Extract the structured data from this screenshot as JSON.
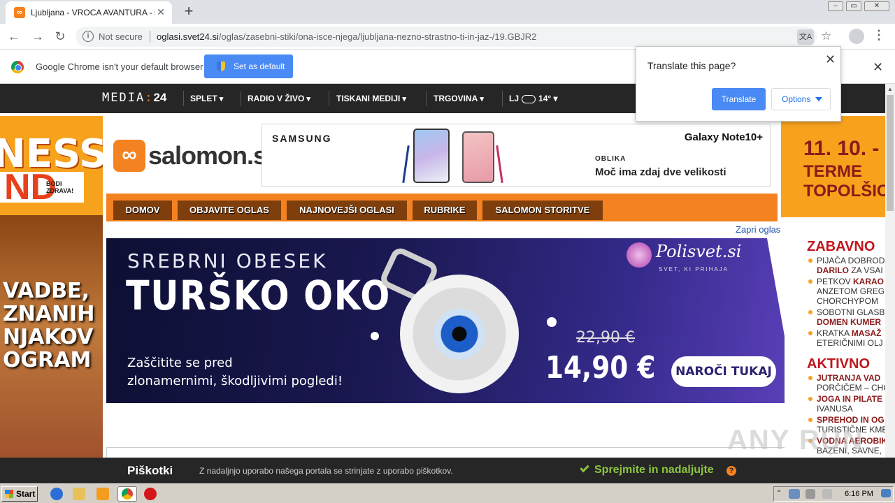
{
  "browser": {
    "tab_title": "Ljubljana - VROCA AVANTURA - salo",
    "tab_close": "✕",
    "new_tab": "+",
    "not_secure": "Not secure",
    "url_host": "oglasi.svet24.si",
    "url_path": "/oglas/zasebni-stiki/ona-isce-njega/ljubljana-nezno-strastno-ti-in-jaz-/19.GBJR2",
    "back": "←",
    "forward": "→",
    "reload": "↻",
    "star": "☆",
    "menu": "⋮"
  },
  "infobar": {
    "message": "Google Chrome isn't your default browser",
    "button": "Set as default",
    "close": "✕"
  },
  "translate_popup": {
    "question": "Translate this page?",
    "translate": "Translate",
    "options": "Options",
    "close": "✕"
  },
  "media24_bar": {
    "logo_text": "MEDIA",
    "logo_num": "24",
    "nav": [
      "SPLET",
      "RADIO V ŽIVO",
      "TISKANI MEDIJI",
      "TRGOVINA"
    ],
    "weather_city": "LJ",
    "weather_temp": "14°"
  },
  "left_ad": {
    "headline": "NESS",
    "nd": "ND",
    "tagline": "BODI ZDRAVA!",
    "lines": "VADBE,\nZNANIH\nNJAKOV\nOGRAM"
  },
  "site": {
    "logo": "salomon.si",
    "nav": [
      "DOMOV",
      "OBJAVITE OGLAS",
      "NAJNOVEJŠI OGLASI",
      "RUBRIKE",
      "SALOMON STORITVE"
    ],
    "close_ad": "Zapri oglas"
  },
  "samsung_ad": {
    "brand": "SAMSUNG",
    "model": "Galaxy Note10+",
    "label": "OBLIKA",
    "tagline": "Moč ima zdaj dve velikosti"
  },
  "banner": {
    "subtitle": "SREBRNI OBESEK",
    "title": "TURŠKO OKO",
    "description": "Zaščitite se pred\nzlonamernimi, škodljivimi pogledi!",
    "brand": "Polisvet.si",
    "brand_sub": "SVET, KI PRIHAJA",
    "old_price": "22,90 €",
    "price": "14,90 €",
    "cta": "NAROČI TUKAJ"
  },
  "right_ad": {
    "date": "11. 10. -",
    "venue": "TERME\nTOPOLŠIC",
    "section1": "ZABAVNO",
    "items1": [
      {
        "a": "PIJAČA DOBROD",
        "b": "DARILO",
        "c": " ZA VSAI"
      },
      {
        "a": "PETKOV ",
        "b": "KARAO",
        "c": "ANZETOM GREG CHORCHYPOM"
      },
      {
        "a": "SOBOTNI GLASB",
        "b": "DOMEN KUMER",
        "c": ""
      },
      {
        "a": "KRATKA ",
        "b": "MASAŽ",
        "c": "ETERIČNIMI OLJ"
      }
    ],
    "section2": "AKTIVNO",
    "items2": [
      {
        "a": "",
        "b": "JUTRANJA VAD",
        "c": "PORČIČEM – CHO"
      },
      {
        "a": "",
        "b": "JOGA IN PILATE",
        "c": "IVANUSA"
      },
      {
        "a": "",
        "b": "SPREHOD IN OG",
        "c": "TURISTIČNE KME"
      },
      {
        "a": "",
        "b": "VODNA AEROBIK",
        "c": "BAZENI, SAVNE,"
      }
    ]
  },
  "cookie_bar": {
    "title": "Piškotki",
    "text": "Z nadaljnjo uporabo našega portala se strinjate z uporabo piškotkov.",
    "accept": "Sprejmite in nadaljujte",
    "help": "?"
  },
  "watermark": "ANY RUN",
  "taskbar": {
    "start": "Start",
    "time": "6:16 PM"
  }
}
